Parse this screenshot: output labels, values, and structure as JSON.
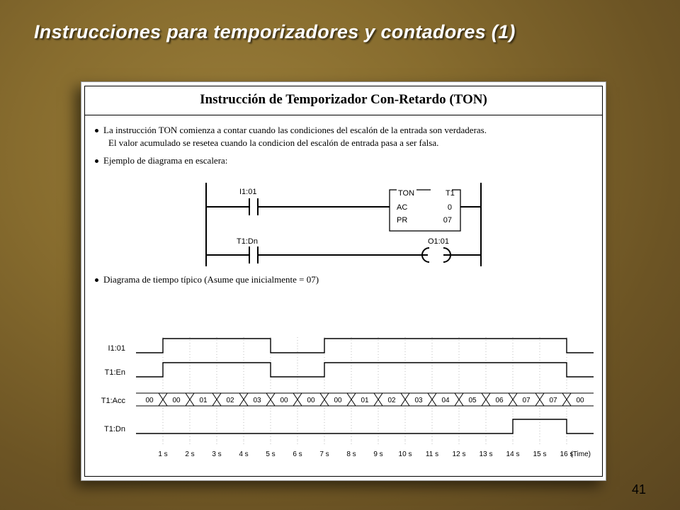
{
  "slide_title": "Instrucciones para temporizadores y contadores (1)",
  "page_number": "41",
  "card": {
    "heading": "Instrucción de Temporizador Con-Retardo (TON)",
    "bullet1_a": "La instrucción TON comienza a contar cuando las condiciones del escalón de la entrada son verdaderas.",
    "bullet1_b": "El valor acumulado se resetea cuando la condicion del escalón de entrada pasa a ser falsa.",
    "bullet2": "Ejemplo de diagrama en escalera:",
    "bullet3": "Diagrama de tiempo típico (Asume que inicialmente = 07)"
  },
  "ladder": {
    "contact1": "I1:01",
    "block_title": "TON",
    "block_tag": "T1",
    "block_row1_l": "AC",
    "block_row1_r": "0",
    "block_row2_l": "PR",
    "block_row2_r": "07",
    "contact2": "T1:Dn",
    "coil": "O1:01"
  },
  "timing": {
    "labels": {
      "r1": "I1:01",
      "r2": "T1:En",
      "r3": "T1:Acc",
      "r4": "T1:Dn",
      "axis": "(Time)"
    },
    "acc": [
      "00",
      "00",
      "01",
      "02",
      "03",
      "00",
      "00",
      "00",
      "01",
      "02",
      "03",
      "04",
      "05",
      "06",
      "07",
      "07",
      "00"
    ],
    "ticks": [
      "1 s",
      "2 s",
      "3 s",
      "4 s",
      "5 s",
      "6 s",
      "7 s",
      "8 s",
      "9 s",
      "10 s",
      "11 s",
      "12 s",
      "13 s",
      "14 s",
      "15 s",
      "16 s"
    ]
  },
  "chart_data": {
    "type": "line",
    "title": "Diagrama de tiempo típico (Asume que inicialmente = 07)",
    "xlabel": "(Time)",
    "x_ticks_seconds": [
      1,
      2,
      3,
      4,
      5,
      6,
      7,
      8,
      9,
      10,
      11,
      12,
      13,
      14,
      15,
      16
    ],
    "series": [
      {
        "name": "I1:01",
        "type": "digital",
        "high_intervals_s": [
          [
            1,
            5
          ],
          [
            7,
            16
          ]
        ]
      },
      {
        "name": "T1:En",
        "type": "digital",
        "high_intervals_s": [
          [
            1,
            5
          ],
          [
            7,
            16
          ]
        ]
      },
      {
        "name": "T1:Acc",
        "type": "step",
        "values_per_second": [
          0,
          0,
          1,
          2,
          3,
          0,
          0,
          0,
          1,
          2,
          3,
          4,
          5,
          6,
          7,
          7,
          0
        ]
      },
      {
        "name": "T1:Dn",
        "type": "digital",
        "high_intervals_s": [
          [
            14,
            16
          ]
        ]
      }
    ],
    "preset": 7
  }
}
